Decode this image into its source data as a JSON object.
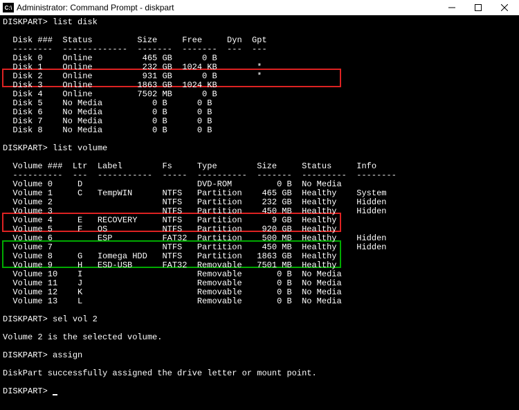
{
  "titlebar": {
    "icon_text": "C:\\",
    "title": "Administrator: Command Prompt - diskpart"
  },
  "terminal": {
    "prompt": "DISKPART>",
    "cmd_list_disk": "list disk",
    "disk_header": "  Disk ###  Status         Size     Free     Dyn  Gpt",
    "disk_divider": "  --------  -------------  -------  -------  ---  ---",
    "disks": [
      "  Disk 0    Online          465 GB      0 B",
      "  Disk 1    Online          232 GB  1024 KB        *",
      "  Disk 2    Online          931 GB      0 B        *",
      "  Disk 3    Online         1863 GB  1024 KB",
      "  Disk 4    Online         7502 MB      0 B",
      "  Disk 5    No Media          0 B      0 B",
      "  Disk 6    No Media          0 B      0 B",
      "  Disk 7    No Media          0 B      0 B",
      "  Disk 8    No Media          0 B      0 B"
    ],
    "cmd_list_volume": "list volume",
    "vol_header": "  Volume ###  Ltr  Label        Fs     Type        Size     Status     Info",
    "vol_divider": "  ----------  ---  -----------  -----  ----------  -------  ---------  --------",
    "volumes": [
      "  Volume 0     D                       DVD-ROM         0 B  No Media",
      "  Volume 1     C   TempWIN      NTFS   Partition    465 GB  Healthy    System",
      "  Volume 2                      NTFS   Partition    232 GB  Healthy    Hidden",
      "  Volume 3                      NTFS   Partition    450 MB  Healthy    Hidden",
      "  Volume 4     E   RECOVERY     NTFS   Partition      9 GB  Healthy",
      "  Volume 5     F   OS           NTFS   Partition    920 GB  Healthy",
      "  Volume 6         ESP          FAT32  Partition    500 MB  Healthy    Hidden",
      "  Volume 7                      NTFS   Partition    450 MB  Healthy    Hidden",
      "  Volume 8     G   Iomega HDD   NTFS   Partition   1863 GB  Healthy",
      "  Volume 9     H   ESD-USB      FAT32  Removable   7501 MB  Healthy",
      "  Volume 10    I                       Removable       0 B  No Media",
      "  Volume 11    J                       Removable       0 B  No Media",
      "  Volume 12    K                       Removable       0 B  No Media",
      "  Volume 13    L                       Removable       0 B  No Media"
    ],
    "cmd_sel_vol": "sel vol 2",
    "msg_selected": "Volume 2 is the selected volume.",
    "cmd_assign": "assign",
    "msg_assigned": "DiskPart successfully assigned the drive letter or mount point."
  }
}
